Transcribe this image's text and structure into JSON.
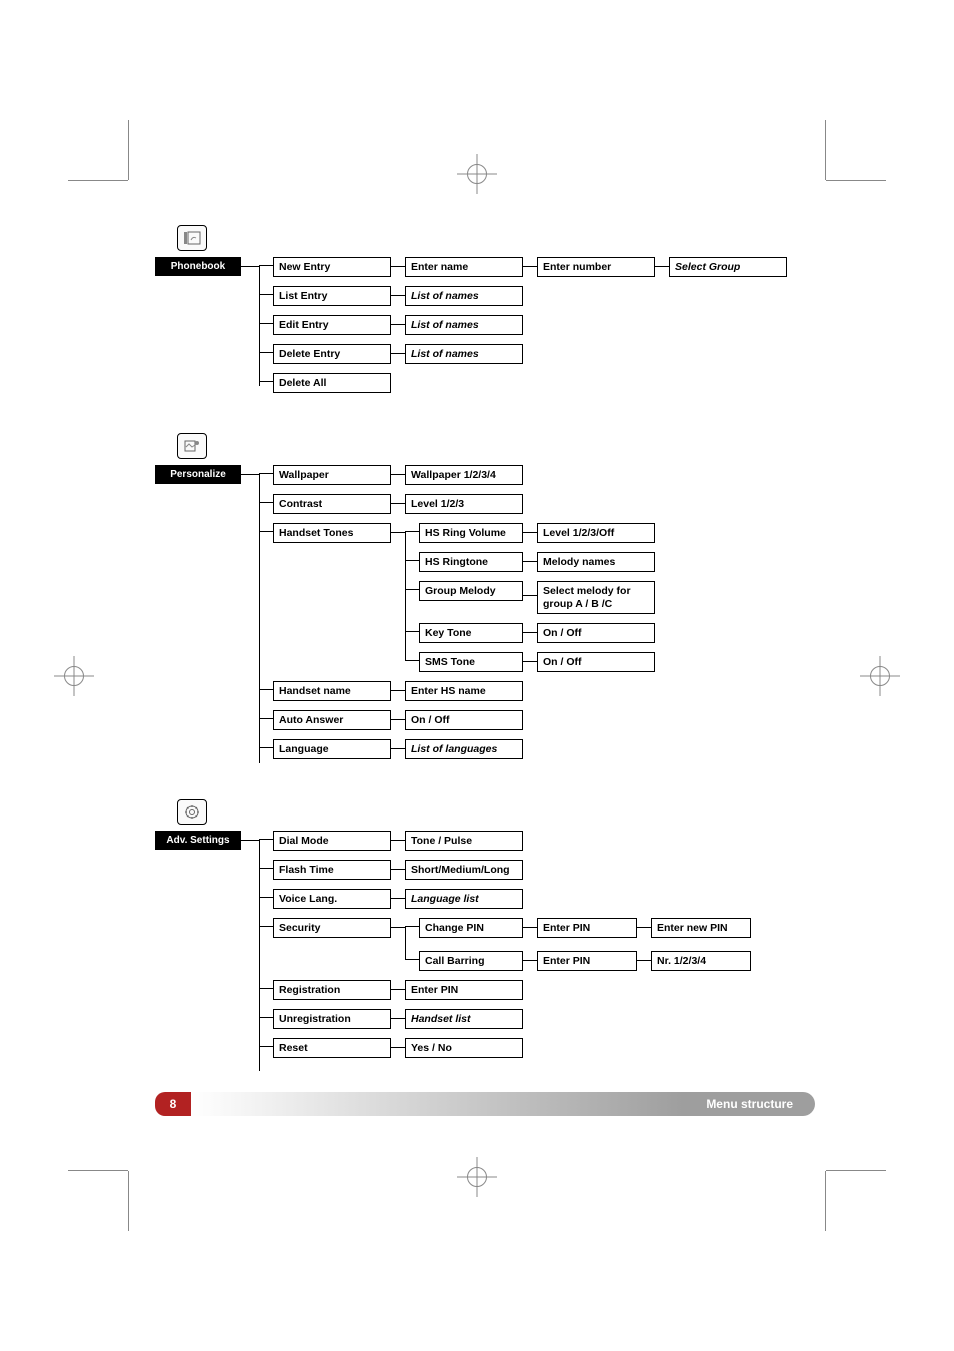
{
  "footer": {
    "page": "8",
    "title": "Menu structure"
  },
  "phonebook": {
    "root": "Phonebook",
    "items": [
      {
        "l2": "New Entry",
        "l3": "Enter name",
        "l4": "Enter number",
        "l5": "Select Group",
        "l5_italic": true
      },
      {
        "l2": "List Entry",
        "l3": "List of names",
        "l3_italic": true
      },
      {
        "l2": "Edit Entry",
        "l3": "List of names",
        "l3_italic": true
      },
      {
        "l2": "Delete Entry",
        "l3": "List of names",
        "l3_italic": true
      },
      {
        "l2": "Delete All"
      }
    ]
  },
  "personalize": {
    "root": "Personalize",
    "items": [
      {
        "l2": "Wallpaper",
        "l3": "Wallpaper 1/2/3/4"
      },
      {
        "l2": "Contrast",
        "l3": "Level 1/2/3"
      },
      {
        "l2": "Handset Tones",
        "sub": [
          {
            "l3": "HS Ring Volume",
            "l4": "Level 1/2/3/Off"
          },
          {
            "l3": "HS Ringtone",
            "l4": "Melody names"
          },
          {
            "l3": "Group Melody",
            "l4": "Select melody for group A / B /C"
          },
          {
            "l3": "Key Tone",
            "l4": "On / Off"
          },
          {
            "l3": "SMS Tone",
            "l4": "On / Off"
          }
        ]
      },
      {
        "l2": "Handset name",
        "l3": "Enter HS name"
      },
      {
        "l2": "Auto Answer",
        "l3": "On / Off"
      },
      {
        "l2": "Language",
        "l3": "List of languages",
        "l3_italic": true
      }
    ]
  },
  "advsettings": {
    "root": "Adv. Settings",
    "items": [
      {
        "l2": "Dial Mode",
        "l3": "Tone / Pulse"
      },
      {
        "l2": "Flash Time",
        "l3": "Short/Medium/Long"
      },
      {
        "l2": "Voice Lang.",
        "l3": "Language list",
        "l3_italic": true
      },
      {
        "l2": "Security",
        "sub": [
          {
            "l3": "Change PIN",
            "l4": "Enter PIN",
            "l5": "Enter new PIN"
          },
          {
            "l3": "Call Barring",
            "l4": "Enter PIN",
            "l5": "Nr. 1/2/3/4"
          }
        ]
      },
      {
        "l2": "Registration",
        "l3": "Enter PIN"
      },
      {
        "l2": "Unregistration",
        "l3": "Handset list",
        "l3_italic": true
      },
      {
        "l2": "Reset",
        "l3": "Yes / No"
      }
    ]
  }
}
